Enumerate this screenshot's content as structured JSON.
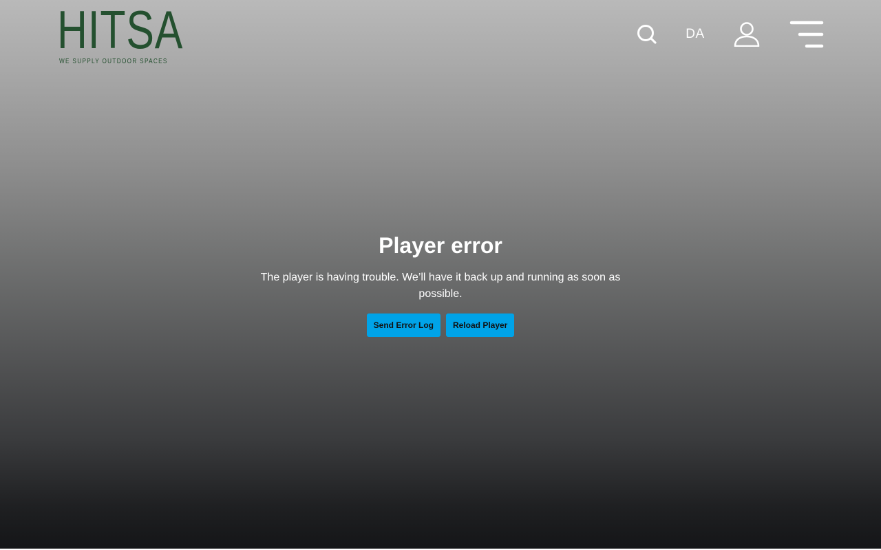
{
  "header": {
    "logo": {
      "name": "HITSA",
      "tagline": "WE SUPPLY OUTDOOR SPACES",
      "color": "#24502f"
    },
    "language": "DA",
    "icons": {
      "search": "search-icon",
      "account": "user-icon",
      "menu": "hamburger-menu-icon"
    }
  },
  "player_error": {
    "title": "Player error",
    "message": "The player is having trouble. We’ll have it back up and running as soon as possible.",
    "buttons": {
      "send_log": "Send Error Log",
      "reload": "Reload Player"
    },
    "button_color": "#00a3e8"
  }
}
